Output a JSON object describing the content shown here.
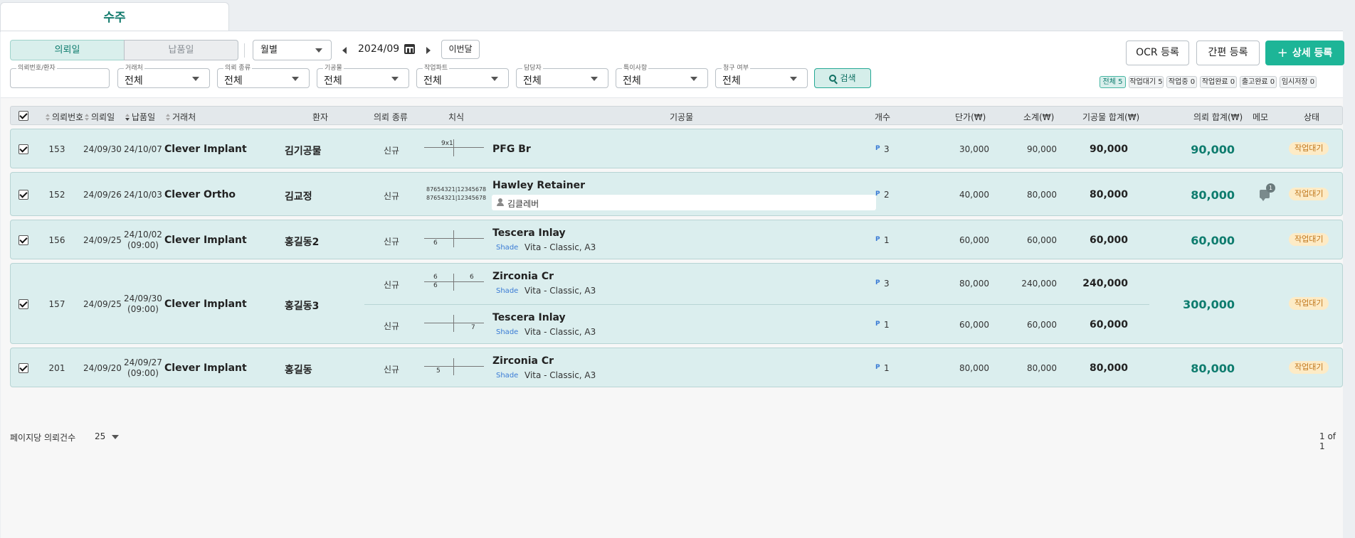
{
  "tab": {
    "label": "수주"
  },
  "toolbar": {
    "seg_request_date": "의뢰일",
    "seg_delivery_date": "납품일",
    "period_select": "월별",
    "current_month": "2024/09",
    "this_month_button": "이번달",
    "search_button": "검색",
    "ocr_button": "OCR 등록",
    "simple_button": "간편 등록",
    "detail_button": "상세 등록"
  },
  "filters": {
    "request_patient": {
      "label": "의뢰번호/환자",
      "value": ""
    },
    "client": {
      "label": "거래처",
      "value": "전체"
    },
    "request_type": {
      "label": "의뢰 종류",
      "value": "전체"
    },
    "prosthesis": {
      "label": "기공물",
      "value": "전체"
    },
    "work_part": {
      "label": "작업파트",
      "value": "전체"
    },
    "manager": {
      "label": "담당자",
      "value": "전체"
    },
    "special_note": {
      "label": "특이사항",
      "value": "전체"
    },
    "billing": {
      "label": "청구 여부",
      "value": "전체"
    }
  },
  "status_chips": [
    "전체 5",
    "작업대기 5",
    "작업중 0",
    "작업완료 0",
    "출고완료 0",
    "임시저장 0"
  ],
  "table": {
    "headers": {
      "request_no": "의뢰번호",
      "request_date": "의뢰일",
      "delivery_date": "납품일",
      "client": "거래처",
      "patient": "환자",
      "request_type": "의뢰 종류",
      "teeth": "치식",
      "prosthesis": "기공물",
      "qty": "개수",
      "unit_price": "단가(₩)",
      "subtotal": "소계(₩)",
      "prosth_total": "기공물 합계(₩)",
      "request_total": "의뢰 합계(₩)",
      "memo": "메모",
      "status": "상태"
    },
    "rows": [
      {
        "request_no": "153",
        "request_date": "24/09/30",
        "delivery_date": "24/10/07",
        "delivery_time": "",
        "client": "Clever Implant",
        "patient": "김기공물",
        "items": [
          {
            "type": "신규",
            "teeth_top_left": "",
            "teeth_top_right": "",
            "teeth_bottom_left": "",
            "teeth_bottom_right": "",
            "teeth_label": "9x1",
            "name": "PFG Br",
            "shade_label": "",
            "shade": "",
            "p": "P",
            "qty": "3",
            "unit_price": "30,000",
            "subtotal": "90,000",
            "prosth_total": "90,000"
          }
        ],
        "request_total": "90,000",
        "status": "작업대기",
        "memo": ""
      },
      {
        "request_no": "152",
        "request_date": "24/09/26",
        "delivery_date": "24/10/03",
        "delivery_time": "",
        "client": "Clever Ortho",
        "patient": "김교정",
        "items": [
          {
            "type": "신규",
            "teeth_line1": "87654321|12345678",
            "teeth_line2": "87654321|12345678",
            "name": "Hawley Retainer",
            "sub_note": "김클레버",
            "p": "P",
            "qty": "2",
            "unit_price": "40,000",
            "subtotal": "80,000",
            "prosth_total": "80,000"
          }
        ],
        "request_total": "80,000",
        "status": "작업대기",
        "memo": "1"
      },
      {
        "request_no": "156",
        "request_date": "24/09/25",
        "delivery_date": "24/10/02",
        "delivery_time": "(09:00)",
        "client": "Clever Implant",
        "patient": "홍길동2",
        "items": [
          {
            "type": "신규",
            "teeth_bottom_left": "6",
            "name": "Tescera Inlay",
            "shade_label": "Shade",
            "shade": "Vita - Classic, A3",
            "p": "P",
            "qty": "1",
            "unit_price": "60,000",
            "subtotal": "60,000",
            "prosth_total": "60,000"
          }
        ],
        "request_total": "60,000",
        "status": "작업대기",
        "memo": ""
      },
      {
        "request_no": "157",
        "request_date": "24/09/25",
        "delivery_date": "24/09/30",
        "delivery_time": "(09:00)",
        "client": "Clever Implant",
        "patient": "홍길동3",
        "items": [
          {
            "type": "신규",
            "teeth_top_left": "6",
            "teeth_top_right": "6",
            "teeth_bottom_left": "6",
            "name": "Zirconia Cr",
            "shade_label": "Shade",
            "shade": "Vita - Classic, A3",
            "p": "P",
            "qty": "3",
            "unit_price": "80,000",
            "subtotal": "240,000",
            "prosth_total": "240,000"
          },
          {
            "type": "신규",
            "teeth_bottom_right": "7",
            "name": "Tescera Inlay",
            "shade_label": "Shade",
            "shade": "Vita - Classic, A3",
            "p": "P",
            "qty": "1",
            "unit_price": "60,000",
            "subtotal": "60,000",
            "prosth_total": "60,000"
          }
        ],
        "request_total": "300,000",
        "status": "작업대기",
        "memo": ""
      },
      {
        "request_no": "201",
        "request_date": "24/09/20",
        "delivery_date": "24/09/27",
        "delivery_time": "(09:00)",
        "client": "Clever Implant",
        "patient": "홍길동",
        "items": [
          {
            "type": "신규",
            "teeth_bottom_left": "5",
            "name": "Zirconia Cr",
            "shade_label": "Shade",
            "shade": "Vita - Classic, A3",
            "p": "P",
            "qty": "1",
            "unit_price": "80,000",
            "subtotal": "80,000",
            "prosth_total": "80,000"
          }
        ],
        "request_total": "80,000",
        "status": "작업대기",
        "memo": ""
      }
    ]
  },
  "footer": {
    "per_page_label": "페이지당 의뢰건수",
    "per_page_value": "25",
    "pagination": "1 of 1"
  },
  "colors": {
    "accent": "#1db597",
    "row_bg": "#dbeeee",
    "total_green": "#0e7c6e",
    "status_bg": "#fdebc6",
    "status_text": "#c0761b"
  }
}
